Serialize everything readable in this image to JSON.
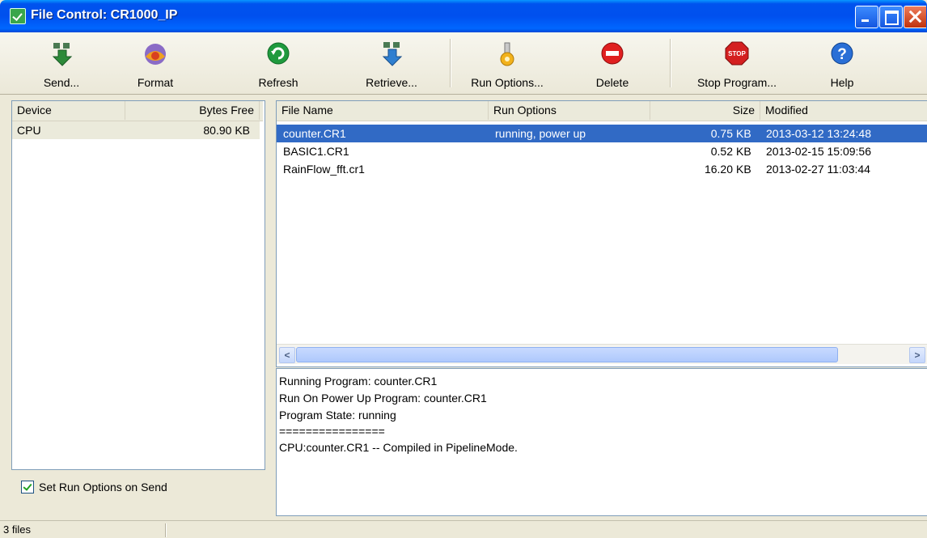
{
  "window": {
    "title": "File Control: CR1000_IP"
  },
  "toolbar": {
    "buttons": [
      {
        "label": "Send...",
        "icon": "send-icon"
      },
      {
        "label": "Format",
        "icon": "format-icon"
      },
      {
        "label": "Refresh",
        "icon": "refresh-icon"
      },
      {
        "label": "Retrieve...",
        "icon": "retrieve-icon"
      },
      {
        "label": "Run Options...",
        "icon": "run-options-icon"
      },
      {
        "label": "Delete",
        "icon": "delete-icon"
      },
      {
        "label": "Stop Program...",
        "icon": "stop-icon"
      },
      {
        "label": "Help",
        "icon": "help-icon"
      }
    ]
  },
  "devices": {
    "columns": [
      "Device",
      "Bytes Free"
    ],
    "rows": [
      {
        "device": "CPU",
        "bytes_free": "80.90 KB"
      }
    ]
  },
  "set_run_options": {
    "label": "Set Run Options on Send",
    "checked": true
  },
  "files": {
    "columns": [
      "File Name",
      "Run Options",
      "Size",
      "Modified"
    ],
    "rows": [
      {
        "name": "counter.CR1",
        "run_options": "running, power up",
        "size": "0.75",
        "unit": "KB",
        "modified": "2013-03-12 13:24:48",
        "selected": true
      },
      {
        "name": "BASIC1.CR1",
        "run_options": "",
        "size": "0.52",
        "unit": "KB",
        "modified": "2013-02-15 15:09:56",
        "selected": false
      },
      {
        "name": "RainFlow_fft.cr1",
        "run_options": "",
        "size": "16.20",
        "unit": "KB",
        "modified": "2013-02-27 11:03:44",
        "selected": false
      }
    ]
  },
  "output": {
    "lines": [
      "Running Program: counter.CR1",
      "Run On Power Up Program: counter.CR1",
      "Program State: running",
      "================",
      "CPU:counter.CR1 -- Compiled in PipelineMode."
    ]
  },
  "status": {
    "text": "3 files"
  },
  "colors": {
    "selection": "#316ac5",
    "titlebar": "#0053ee"
  }
}
